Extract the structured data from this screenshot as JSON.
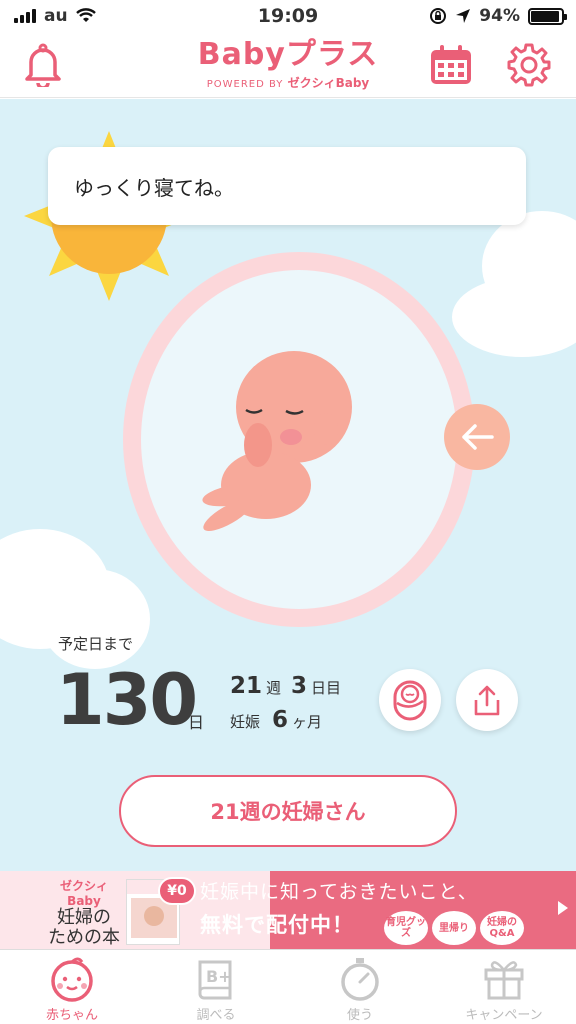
{
  "status_bar": {
    "carrier": "au",
    "time": "19:09",
    "battery": "94%",
    "battery_level": 0.94
  },
  "header": {
    "logo_main": "Babyプラス",
    "logo_powered": "POWERED BY",
    "logo_brand": "ゼクシィBaby",
    "icons": [
      "bell-icon",
      "calendar-icon",
      "gear-icon"
    ]
  },
  "main": {
    "speech": "ゆっくり寝てね。",
    "until_label": "予定日まで",
    "days_remaining": "130",
    "days_unit": "日",
    "weeks": "21",
    "weeks_unit": "週",
    "days_in_week": "3",
    "days_in_week_unit": "日目",
    "pregnancy_label": "妊娠",
    "months": "6",
    "months_unit": "ヶ月",
    "week_button": "21週の妊婦さん"
  },
  "banner": {
    "book_brand": "ゼクシィBaby",
    "book_title_1": "妊婦の",
    "book_title_2": "ための本",
    "price": "¥0",
    "line1": "妊娠中に知っておきたいこと、",
    "line2": "無料で配付中！",
    "tags": [
      "育児グッズ",
      "里帰り",
      "妊婦のQ&A"
    ]
  },
  "tabs": [
    {
      "label": "赤ちゃん",
      "icon": "baby-face-icon",
      "active": true
    },
    {
      "label": "調べる",
      "icon": "book-plus-icon",
      "active": false
    },
    {
      "label": "使う",
      "icon": "stopwatch-icon",
      "active": false
    },
    {
      "label": "キャンペーン",
      "icon": "gift-icon",
      "active": false
    }
  ],
  "colors": {
    "accent": "#ea5f77",
    "sky": "#daf1f8",
    "womb": "#fcd7da",
    "back_button": "#f9b7a1"
  }
}
